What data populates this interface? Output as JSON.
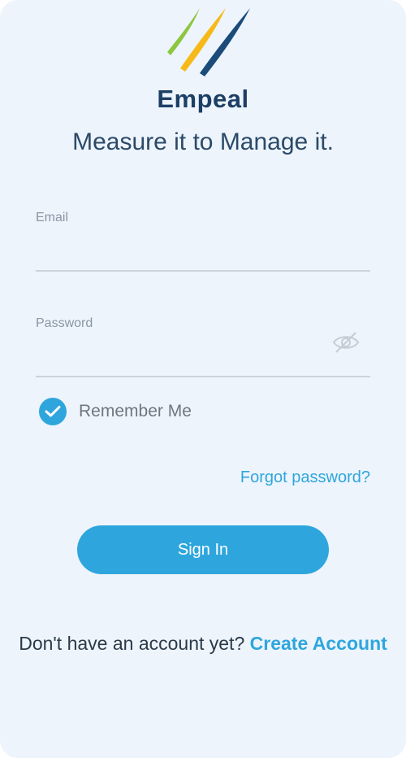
{
  "brand": {
    "name": "Empeal",
    "tagline": "Measure it to Manage it.",
    "logo_colors": [
      "#8dc63f",
      "#f7b918",
      "#1a4b7a"
    ]
  },
  "form": {
    "email": {
      "label": "Email",
      "value": ""
    },
    "password": {
      "label": "Password",
      "value": "",
      "toggle_icon": "eye-off-icon"
    },
    "remember_me": {
      "label": "Remember Me",
      "checked": true
    },
    "forgot_password_label": "Forgot password?",
    "submit_label": "Sign In"
  },
  "signup": {
    "prompt": "Don't have an account yet?",
    "link_label": "Create Account"
  },
  "colors": {
    "accent": "#2ea6dd",
    "background": "#edf4fc",
    "text_dark": "#2b4a68",
    "brand_navy": "#1d3f66"
  }
}
